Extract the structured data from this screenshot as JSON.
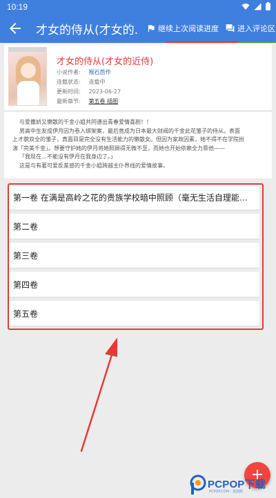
{
  "status_bar": {
    "time": "10:19",
    "icons": [
      "wifi-icon",
      "signal-icon",
      "battery-icon"
    ]
  },
  "app_bar": {
    "title": "才女的侍从(才女的…",
    "actions": [
      {
        "icon": "flag-icon",
        "label": "继续上次阅读进度"
      },
      {
        "icon": "comment-icon",
        "label": "进入评论区"
      }
    ]
  },
  "book": {
    "title": "才女的侍从(才女的近侍)",
    "meta": [
      {
        "key": "小说作者:",
        "value": "猴石茴作"
      },
      {
        "key": "连载状态:",
        "value": "连载中"
      },
      {
        "key": "更新时间:",
        "value": "2023-06-27"
      },
      {
        "key": "最新章节:",
        "value": "第五卷 插图"
      }
    ]
  },
  "description": [
    "与爱撒娇又懒散的千金小姐共同谱出青春爱情喜剧！！",
    "男高中生友成伊月因为卷入绑架案，最后竟成为日本最大财阀的千金此花雏子的侍从。表面",
    "上才貌双全的雏子，真面目是完全没有生活能力的懒散女。但因为家政因素，她不得不在学院扮",
    "演「完美千金」。想要守护她的伊月将她照顾得无微不至，而她也开始依赖全力靠他——",
    "「我现在…不能没有伊月在我身边了。」",
    "这是与有著可爱反差感的千金小姐跨越主仆界线的爱情故事。"
  ],
  "volumes": [
    "第一卷 在满是高岭之花的贵族学校暗中照顾（毫无生活自理能力的…",
    "第二卷",
    "第三卷",
    "第四卷",
    "第五卷"
  ],
  "fab": {
    "label": "+"
  },
  "watermark": {
    "text": "PCPOP",
    "text_cn": "下载",
    "sub": "PCPOP.COM · 泡泡网"
  },
  "colors": {
    "primary": "#3f7fde",
    "accent_red": "#e53935",
    "accent_green": "#43a047",
    "background": "#ececec"
  }
}
